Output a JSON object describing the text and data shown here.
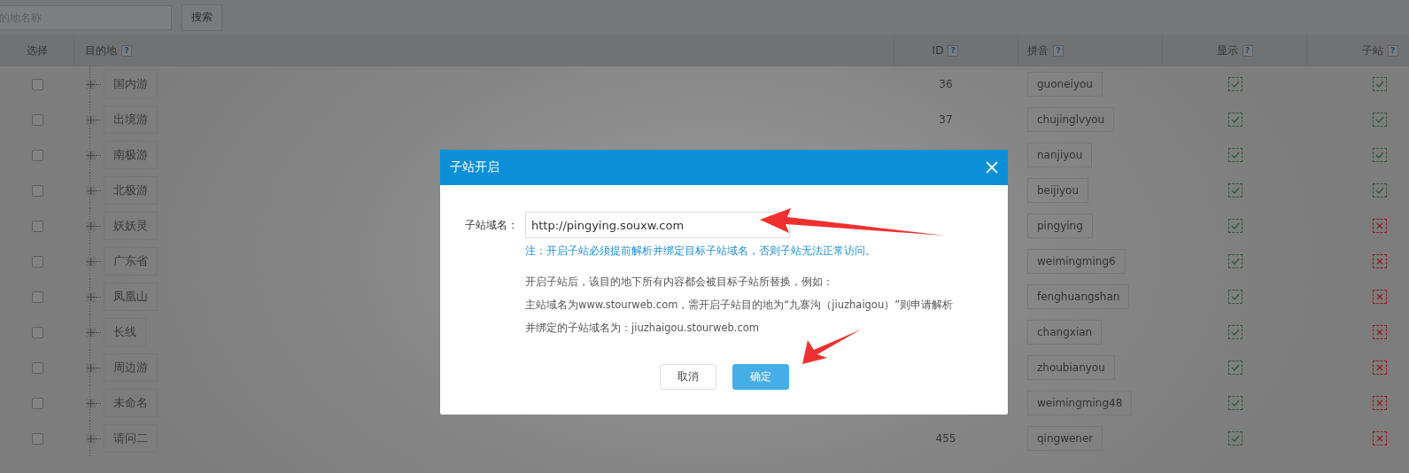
{
  "toolbar": {
    "search": {
      "placeholder": "的地名称"
    },
    "search_button": "搜索"
  },
  "table": {
    "columns": [
      {
        "label": "选择"
      },
      {
        "label": "目的地",
        "help": "?"
      },
      {
        "label": "ID",
        "help": "?"
      },
      {
        "label": "拼音",
        "help": "?"
      },
      {
        "label": "显示",
        "help": "?"
      },
      {
        "label": "子站",
        "help": "?"
      }
    ],
    "rows": [
      {
        "selected": false,
        "expanded": false,
        "name": "国内游",
        "id": "36",
        "pinyin": "guoneiyou",
        "display": true,
        "substation": true
      },
      {
        "selected": false,
        "expanded": false,
        "name": "出境游",
        "id": "37",
        "pinyin": "chujinglvyou",
        "display": true,
        "substation": true
      },
      {
        "selected": false,
        "expanded": false,
        "name": "南极游",
        "pinyin": "nanjiyou",
        "display": true,
        "substation": true
      },
      {
        "selected": false,
        "expanded": false,
        "name": "北极游",
        "pinyin": "beijiyou",
        "display": true,
        "substation": true
      },
      {
        "selected": false,
        "expanded": false,
        "name": "妖妖灵",
        "pinyin": "pingying",
        "display": true,
        "substation": false
      },
      {
        "selected": false,
        "expanded": false,
        "name": "广东省",
        "pinyin": "weimingming6",
        "display": true,
        "substation": false
      },
      {
        "selected": false,
        "expanded": false,
        "name": "凤凰山",
        "pinyin": "fenghuangshan",
        "display": true,
        "substation": false
      },
      {
        "selected": false,
        "expanded": false,
        "name": "长线",
        "pinyin": "changxian",
        "display": true,
        "substation": false
      },
      {
        "selected": false,
        "expanded": false,
        "name": "周边游",
        "pinyin": "zhoubianyou",
        "display": true,
        "substation": false
      },
      {
        "selected": false,
        "expanded": false,
        "name": "未命名",
        "pinyin": "weimingming48",
        "display": true,
        "substation": false
      },
      {
        "selected": false,
        "expanded": false,
        "name": "请问二",
        "id": "455",
        "pinyin": "qingwener",
        "display": true,
        "substation": false
      }
    ]
  },
  "dialog": {
    "title": "子站开启",
    "field_label": "子站域名：",
    "field_value": "http://pingying.souxw.com",
    "note": "注：开启子站必须提前解析并绑定目标子站域名，否则子站无法正常访问。",
    "description": [
      "开启子站后，该目的地下所有内容都会被目标子站所替换，例如：",
      "主站域名为www.stourweb.com，需开启子站目的地为“九寨沟（jiuzhaigou）”则申请解析",
      "并绑定的子站域名为：jiuzhaigou.stourweb.com"
    ],
    "buttons": [
      {
        "label": "取消",
        "kind": "secondary"
      },
      {
        "label": "确定",
        "kind": "primary"
      }
    ]
  }
}
